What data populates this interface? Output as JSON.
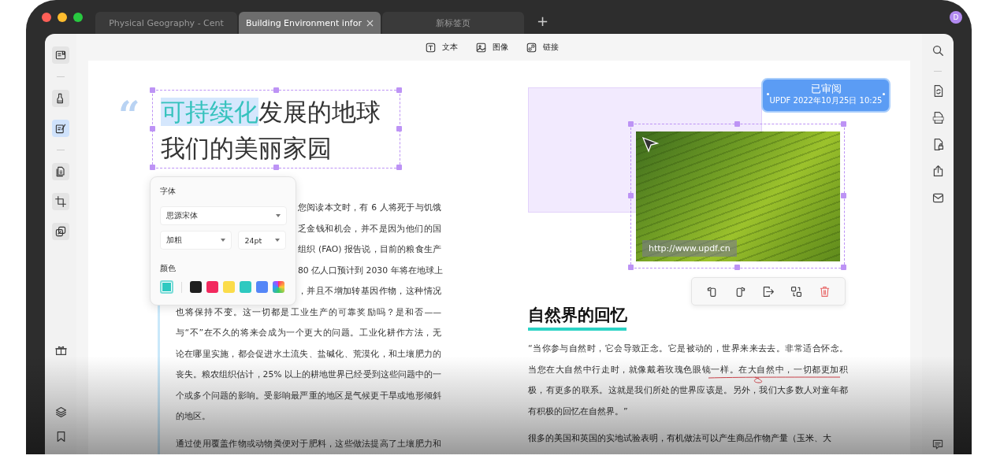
{
  "tabs": [
    {
      "label": "Physical Geography - Cent",
      "selected": false
    },
    {
      "label": "Building Environment infor",
      "selected": true
    },
    {
      "label": "新标签页",
      "selected": false
    }
  ],
  "new_tab": "+",
  "avatar": {
    "initial": "D"
  },
  "left_sidebar": {
    "groups": [
      [
        {
          "kind": "reader",
          "selected": false
        }
      ],
      [
        {
          "kind": "highlighter",
          "selected": false
        },
        {
          "kind": "edit",
          "selected": true
        }
      ],
      [
        {
          "kind": "pages",
          "selected": false
        },
        {
          "kind": "crop",
          "selected": false
        },
        {
          "kind": "layers",
          "selected": false
        }
      ]
    ],
    "bottom": [
      {
        "kind": "gift"
      },
      {
        "kind": "stack"
      },
      {
        "kind": "bookmark"
      }
    ]
  },
  "toolbar": [
    {
      "kind": "text",
      "label": "文本"
    },
    {
      "kind": "image",
      "label": "图像"
    },
    {
      "kind": "link",
      "label": "链接"
    }
  ],
  "right_sidebar": {
    "top": [
      {
        "kind": "search"
      }
    ],
    "tools": [
      {
        "kind": "convert"
      },
      {
        "kind": "pdfa"
      },
      {
        "kind": "protect"
      },
      {
        "kind": "share"
      },
      {
        "kind": "mail"
      }
    ],
    "bottom": [
      {
        "kind": "comment"
      }
    ]
  },
  "document": {
    "left": {
      "quote_mark": "“",
      "title": {
        "highlighted": "可持续化",
        "line_1_rest": "发展的地球",
        "line_2": "我们的美丽家园"
      },
      "lines": [
        {
          "text": "您阅读本文时，有 6 人将死于与饥饿",
          "covered": true
        },
        {
          "text": "乏金钱和机会，并不是因为他们的国",
          "covered": true
        },
        {
          "text": "组织 (FAO) 报告说，目前的粮食生产",
          "covered": true
        },
        {
          "text": "80 亿人口预计到 2030 年将在地球上",
          "covered": true
        },
        {
          "text": "，并且不增加转基因作物，这种情况",
          "covered": true
        },
        {
          "text": "也将保持不变。这一切都是工业生产的可靠奖励吗？是和否——",
          "covered": false
        },
        {
          "text": "与“不”在不久的将来会成为一个更大的问题。工业化耕作方法，无",
          "covered": false
        },
        {
          "text": "论在哪里实施，都会促进水土流失、盐碱化、荒漠化，和土壤肥力的",
          "covered": false
        },
        {
          "text": "丧失。粮农组织估计，25% 以上的耕地世界已经受到这些问题中的一",
          "covered": false
        },
        {
          "text": "个或多个问题的影响。受影响最严重的地区是气候更干旱或地形倾斜",
          "covered": false
        },
        {
          "text": "的地区。",
          "covered": false
        }
      ],
      "next_paragraph": "通过使用覆盖作物或动物粪便对于肥料，这些做法提高了土壤肥力和"
    },
    "format_popup": {
      "font_label": "字体",
      "font": "思源宋体",
      "weight": "加粗",
      "size": "24pt",
      "color_label": "颜色",
      "current_swatch": {
        "color": "#2ec9c0"
      },
      "swatches": [
        {
          "kind": "solid",
          "color": "#1f1f1f"
        },
        {
          "kind": "solid",
          "color": "#f2295e"
        },
        {
          "kind": "solid",
          "color": "#fbdc4a"
        },
        {
          "kind": "solid",
          "color": "#2ec9c0"
        },
        {
          "kind": "solid",
          "color": "#5486f7"
        },
        {
          "kind": "gradient"
        }
      ]
    },
    "right": {
      "stamp": {
        "title": "已审阅",
        "subtitle": "UPDF 2022年10月25日 10:25"
      },
      "image": {
        "link_label": "http://www.updf.cn"
      },
      "image_toolbar": [
        {
          "kind": "rotate-left"
        },
        {
          "kind": "rotate-right"
        },
        {
          "kind": "extract"
        },
        {
          "kind": "replace"
        },
        {
          "kind": "delete"
        }
      ],
      "heading": "自然界的回忆",
      "lines": [
        {
          "text": "“当你参与自然时，它会导致正念。它是被动的，世界来来去去。非常适合怀念。",
          "ink_underline": false
        },
        {
          "text": "当您在大自然中行走时，就像戴着玫瑰色眼镜一样。在大自然中，一切都更加积",
          "ink_underline": true
        },
        {
          "text": "极，有更多的联系。这就是我们所处的世界应该是。另外，我们大多数人对童年都",
          "ink_underline": false
        },
        {
          "text": "有积极的回忆在自然界。”",
          "ink_underline": false
        }
      ],
      "next_paragraph": "很多的美国和英国的实地试验表明，有机做法可以产生商品作物产量（玉米、大"
    }
  }
}
